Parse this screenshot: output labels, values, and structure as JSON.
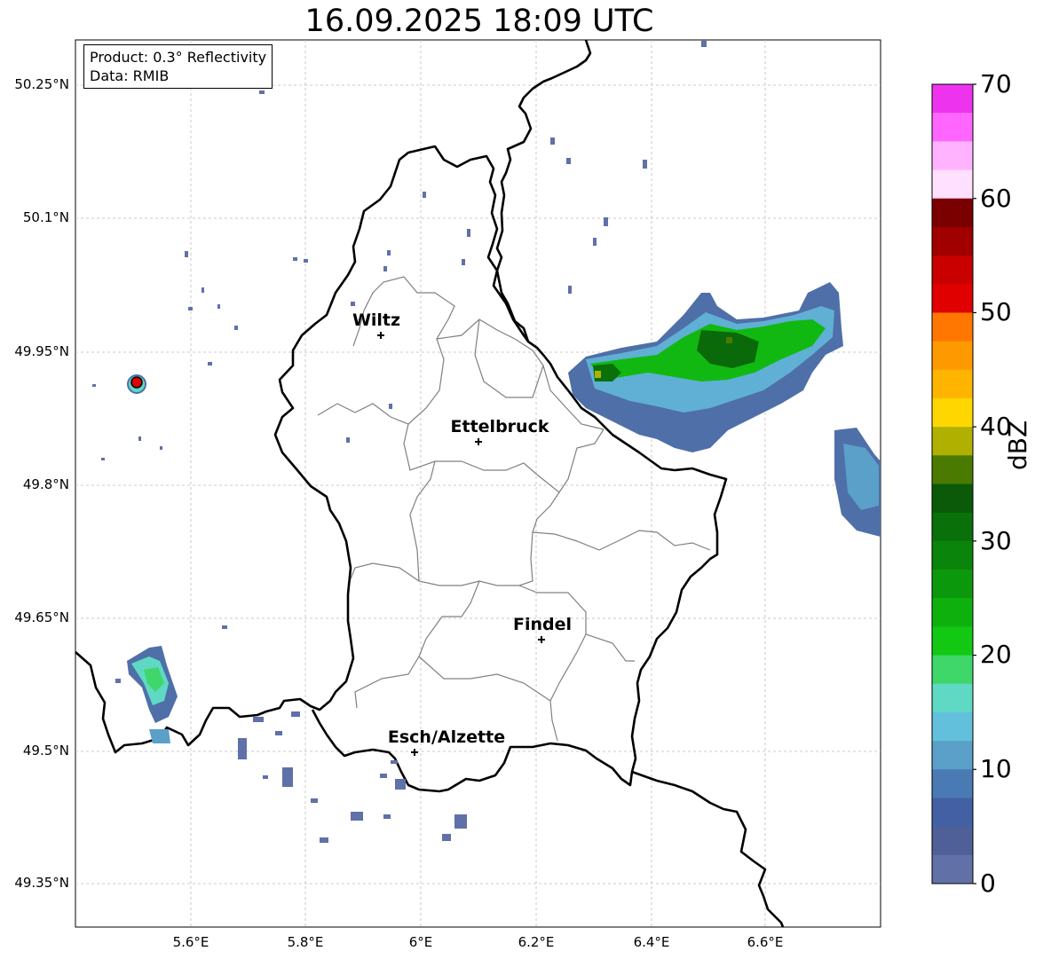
{
  "title": "16.09.2025 18:09 UTC",
  "info": {
    "product": "Product: 0.3° Reflectivity",
    "data": "Data: RMIB"
  },
  "axes": {
    "lat_labels": [
      "50.25°N",
      "50.1°N",
      "49.95°N",
      "49.8°N",
      "49.65°N",
      "49.5°N",
      "49.35°N"
    ],
    "lon_labels": [
      "5.6°E",
      "5.8°E",
      "6°E",
      "6.2°E",
      "6.4°E",
      "6.6°E"
    ]
  },
  "cities": [
    {
      "name": "Wiltz"
    },
    {
      "name": "Ettelbruck"
    },
    {
      "name": "Findel"
    },
    {
      "name": "Esch/Alzette"
    }
  ],
  "colorbar": {
    "label": "dBZ",
    "ticks": [
      "70",
      "60",
      "50",
      "40",
      "30",
      "20",
      "10",
      "0"
    ],
    "colors": [
      "#ee33ee",
      "#ff66ff",
      "#ffb3ff",
      "#ffe0ff",
      "#7a0000",
      "#a00000",
      "#c80000",
      "#e00000",
      "#ff7700",
      "#ff9900",
      "#ffb400",
      "#ffd700",
      "#b0b000",
      "#4a7a00",
      "#0a5a0a",
      "#0a700a",
      "#0a840a",
      "#0c980c",
      "#0eb00e",
      "#12c812",
      "#3fd66a",
      "#5fd9c4",
      "#63c0dc",
      "#5aa0c8",
      "#4a7ab4",
      "#4460a4",
      "#4f6098",
      "#6270a8"
    ]
  },
  "radar_marker_color": "#e00000"
}
